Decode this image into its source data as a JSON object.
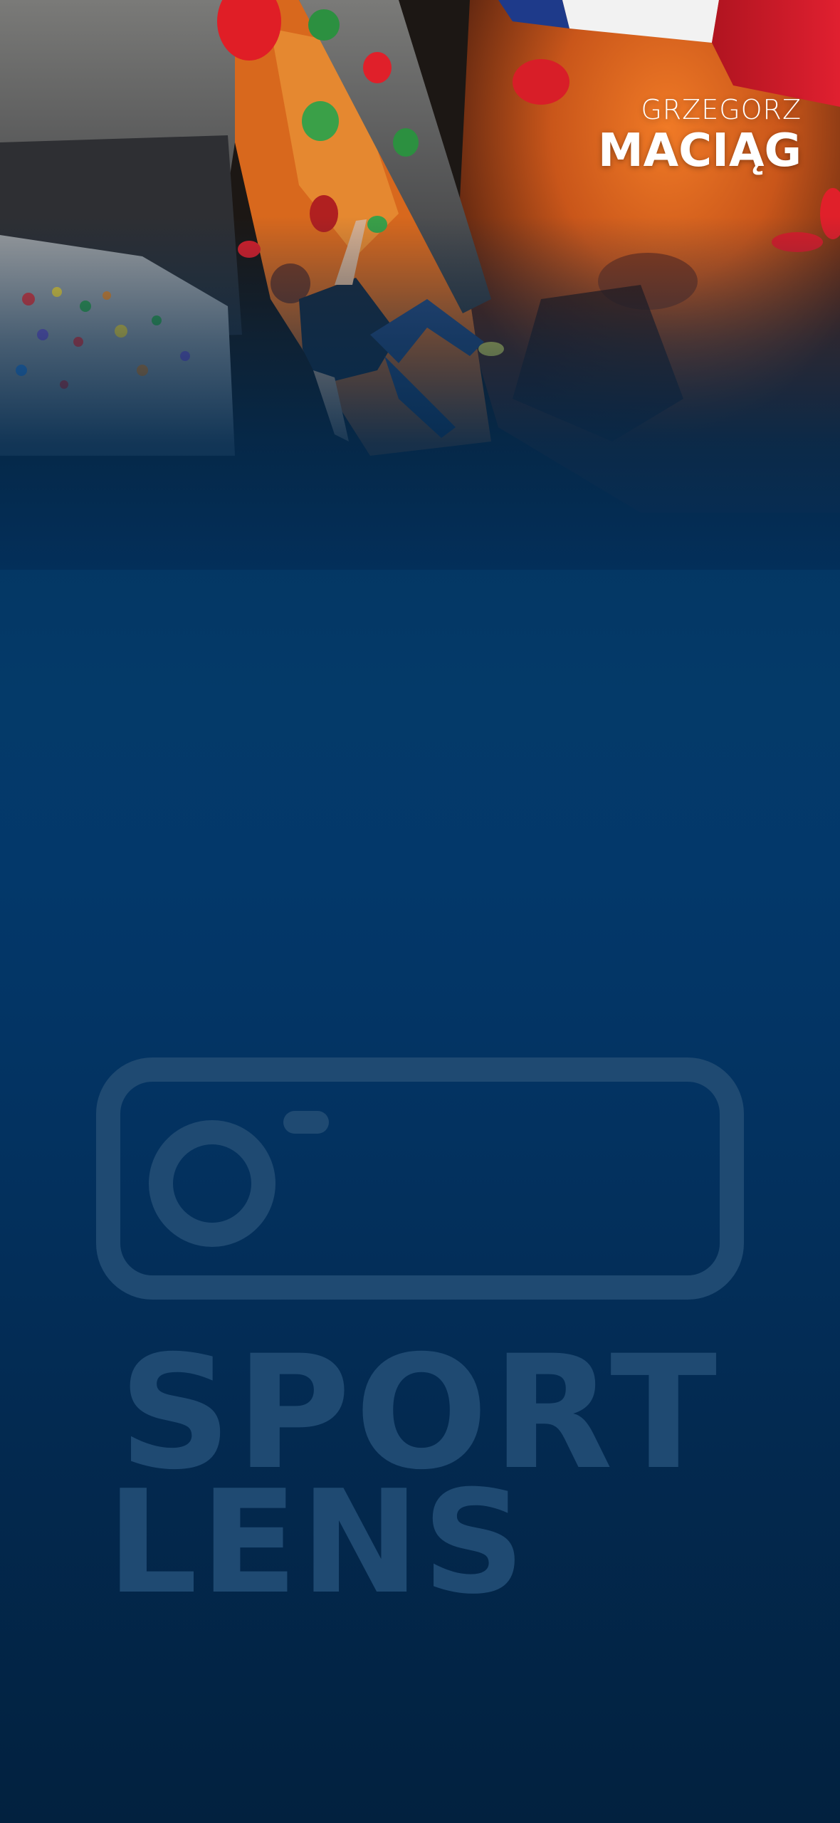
{
  "athlete": {
    "first_name": "GRZEGORZ",
    "last_name": "MACIĄG"
  },
  "hero": {
    "photo_subject": "climber on indoor bouldering wall"
  },
  "brand": {
    "logo_text_line1": "SPORT",
    "logo_text_line2": "LENS",
    "icon": "camera-icon"
  },
  "colors": {
    "background_top": "#032a4e",
    "background_mid": "#043a69",
    "background_bottom": "#02213f",
    "wall_orange": "#d8621a",
    "flag_red": "#d21a24",
    "watermark": "#1f4a72"
  }
}
